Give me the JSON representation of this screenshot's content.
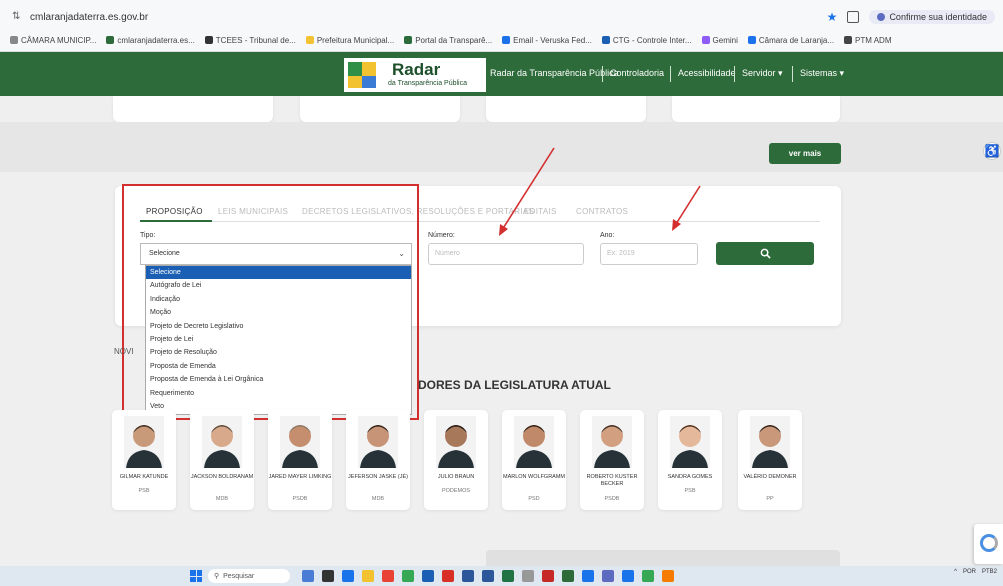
{
  "browser": {
    "url": "cmlaranjadaterra.es.gov.br",
    "identity_chip": "Confirme sua identidade",
    "bookmarks": [
      {
        "label": "CÂMARA MUNICIP...",
        "color": "#888"
      },
      {
        "label": "cmlaranjadaterra.es...",
        "color": "#2e6b3a"
      },
      {
        "label": "TCEES - Tribunal de...",
        "color": "#333"
      },
      {
        "label": "Prefeitura Municipal...",
        "color": "#f2c230"
      },
      {
        "label": "Portal da Transparê...",
        "color": "#2e6b3a"
      },
      {
        "label": "Email - Veruska Fed...",
        "color": "#1a73e8"
      },
      {
        "label": "CTG - Controle Inter...",
        "color": "#1a5fb4"
      },
      {
        "label": "Gemini",
        "color": "#8e5cf7"
      },
      {
        "label": "Câmara de Laranja...",
        "color": "#1a73e8"
      },
      {
        "label": "PTM ADM",
        "color": "#444"
      }
    ]
  },
  "header": {
    "logo_title": "Radar",
    "logo_subtitle": "da Transparência Pública",
    "site_name": "Radar da Transparência Pública",
    "links": [
      "Controladoria",
      "Acessibilidade",
      "Servidor ▾",
      "Sistemas ▾"
    ]
  },
  "ver_mais": "ver mais",
  "search_panel": {
    "tabs": [
      "PROPOSIÇÃO",
      "LEIS MUNICIPAIS",
      "DECRETOS LEGISLATIVOS, RESOLUÇÕES E PORTARIAS",
      "EDITAIS",
      "CONTRATOS"
    ],
    "tipo_label": "Tipo:",
    "tipo_value": "Selecione",
    "numero_label": "Número:",
    "numero_placeholder": "Número",
    "ano_label": "Ano:",
    "ano_placeholder": "Ex: 2019",
    "dropdown_options": [
      "Selecione",
      "Autógrafo de Lei",
      "Indicação",
      "Moção",
      "Projeto de Decreto Legislativo",
      "Projeto de Lei",
      "Projeto de Resolução",
      "Proposta de Emenda",
      "Proposta de Emenda à Lei Orgânica",
      "Requerimento",
      "Veto"
    ]
  },
  "broken_image_alt": "NOVI",
  "section_title": "DORES DA LEGISLATURA ATUAL",
  "members": [
    {
      "name": "GILMAR KATUNDE",
      "party": "PSB"
    },
    {
      "name": "JACKSON BOLDRANAM",
      "party": "MDB"
    },
    {
      "name": "JARED MAYER LIMKING",
      "party": "PSDB"
    },
    {
      "name": "JEFERSON JASKE (JÉ)",
      "party": "MDB"
    },
    {
      "name": "JULIO BRAUN",
      "party": "PODEMOS"
    },
    {
      "name": "MARLON WOLFGRAMM",
      "party": "PSD"
    },
    {
      "name": "ROBERTO KUSTER BECKER",
      "party": "PSDB"
    },
    {
      "name": "SANDRA GOMES",
      "party": "PSB"
    },
    {
      "name": "VALÉRIO DEMONER",
      "party": "PP"
    }
  ],
  "taskbar": {
    "search_placeholder": "Pesquisar",
    "tray_lang": "POR",
    "tray_lang2": "PTB2"
  }
}
